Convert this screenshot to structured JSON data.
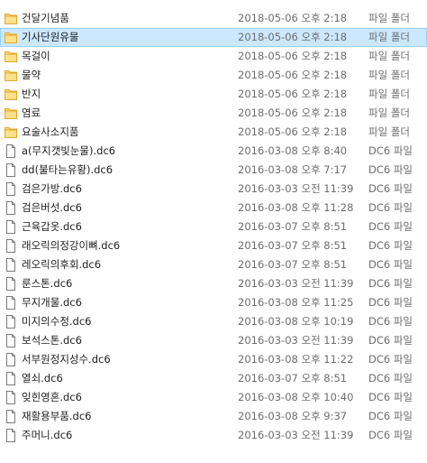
{
  "colors": {
    "selection_bg": "#cce8ff",
    "selection_border": "#99d1ff",
    "folder": "#ffd86b",
    "secondary_text": "#6d6d6d"
  },
  "files": [
    {
      "name": "건달기념품",
      "date": "2018-05-06 오후 2:18",
      "type": "파일 폴더",
      "icon": "folder-icon",
      "selected": false
    },
    {
      "name": "기사단원유물",
      "date": "2018-05-06 오후 2:18",
      "type": "파일 폴더",
      "icon": "folder-icon",
      "selected": true
    },
    {
      "name": "목걸이",
      "date": "2018-05-06 오후 2:18",
      "type": "파일 폴더",
      "icon": "folder-icon",
      "selected": false
    },
    {
      "name": "물약",
      "date": "2018-05-06 오후 2:18",
      "type": "파일 폴더",
      "icon": "folder-icon",
      "selected": false
    },
    {
      "name": "반지",
      "date": "2018-05-06 오후 2:18",
      "type": "파일 폴더",
      "icon": "folder-icon",
      "selected": false
    },
    {
      "name": "염료",
      "date": "2018-05-06 오후 2:18",
      "type": "파일 폴더",
      "icon": "folder-icon",
      "selected": false
    },
    {
      "name": "요술사소지품",
      "date": "2018-05-06 오후 2:18",
      "type": "파일 폴더",
      "icon": "folder-icon",
      "selected": false
    },
    {
      "name": "a(무지갯빛눈물).dc6",
      "date": "2016-03-08 오후 8:40",
      "type": "DC6 파일",
      "icon": "file-icon",
      "selected": false
    },
    {
      "name": "dd(불타는유황).dc6",
      "date": "2016-03-08 오후 7:17",
      "type": "DC6 파일",
      "icon": "file-icon",
      "selected": false
    },
    {
      "name": "검은가방.dc6",
      "date": "2016-03-03 오전 11:39",
      "type": "DC6 파일",
      "icon": "file-icon",
      "selected": false
    },
    {
      "name": "검은버섯.dc6",
      "date": "2016-03-08 오후 11:28",
      "type": "DC6 파일",
      "icon": "file-icon",
      "selected": false
    },
    {
      "name": "근육갑옷.dc6",
      "date": "2016-03-07 오후 8:51",
      "type": "DC6 파일",
      "icon": "file-icon",
      "selected": false
    },
    {
      "name": "래오릭의정강이뼈.dc6",
      "date": "2016-03-07 오후 8:51",
      "type": "DC6 파일",
      "icon": "file-icon",
      "selected": false
    },
    {
      "name": "레오릭의후회.dc6",
      "date": "2016-03-07 오후 8:51",
      "type": "DC6 파일",
      "icon": "file-icon",
      "selected": false
    },
    {
      "name": "룬스톤.dc6",
      "date": "2016-03-03 오전 11:39",
      "type": "DC6 파일",
      "icon": "file-icon",
      "selected": false
    },
    {
      "name": "무지개물.dc6",
      "date": "2016-03-08 오후 11:25",
      "type": "DC6 파일",
      "icon": "file-icon",
      "selected": false
    },
    {
      "name": "미지의수정.dc6",
      "date": "2016-03-08 오후 10:19",
      "type": "DC6 파일",
      "icon": "file-icon",
      "selected": false
    },
    {
      "name": "보석스톤.dc6",
      "date": "2016-03-03 오전 11:39",
      "type": "DC6 파일",
      "icon": "file-icon",
      "selected": false
    },
    {
      "name": "서부원정지성수.dc6",
      "date": "2016-03-08 오후 11:22",
      "type": "DC6 파일",
      "icon": "file-icon",
      "selected": false
    },
    {
      "name": "열쇠.dc6",
      "date": "2016-03-07 오후 8:51",
      "type": "DC6 파일",
      "icon": "file-icon",
      "selected": false
    },
    {
      "name": "잊힌영혼.dc6",
      "date": "2016-03-08 오후 10:40",
      "type": "DC6 파일",
      "icon": "file-icon",
      "selected": false
    },
    {
      "name": "재활용부품.dc6",
      "date": "2016-03-08 오후 9:37",
      "type": "DC6 파일",
      "icon": "file-icon",
      "selected": false
    },
    {
      "name": "주머니.dc6",
      "date": "2016-03-03 오전 11:39",
      "type": "DC6 파일",
      "icon": "file-icon",
      "selected": false
    }
  ]
}
